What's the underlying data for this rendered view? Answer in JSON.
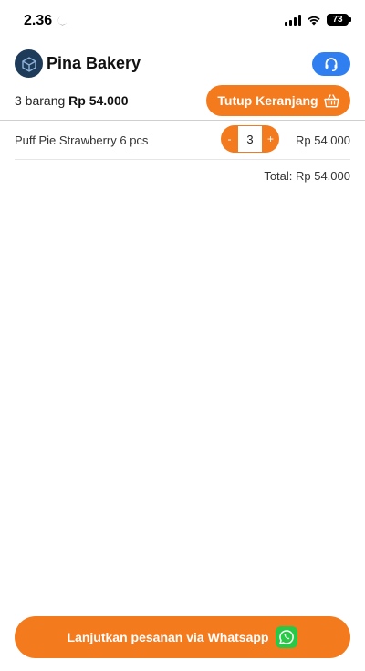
{
  "status_bar": {
    "time": "2.36",
    "battery": "73",
    "moon_icon": "moon-icon",
    "signal_icon": "signal-icon",
    "wifi_icon": "wifi-icon"
  },
  "header": {
    "store_name": "Pina Bakery",
    "logo_icon": "bakery-logo-icon",
    "support_icon": "headset-icon"
  },
  "summary": {
    "item_count": "3 barang",
    "total": "Rp 54.000",
    "close_cart_label": "Tutup Keranjang",
    "close_cart_icon": "basket-icon"
  },
  "cart": {
    "items": [
      {
        "name": "Puff Pie Strawberry 6 pcs",
        "decrement": "-",
        "quantity": "3",
        "increment": "+",
        "price": "Rp 54.000"
      }
    ],
    "total_label": "Total: Rp 54.000"
  },
  "cta": {
    "label": "Lanjutkan pesanan via Whatsapp",
    "icon": "whatsapp-icon"
  },
  "colors": {
    "accent": "#f47a1e",
    "support": "#2f7ff0",
    "whatsapp": "#29c847",
    "logo_bg": "#1f3b5a"
  }
}
